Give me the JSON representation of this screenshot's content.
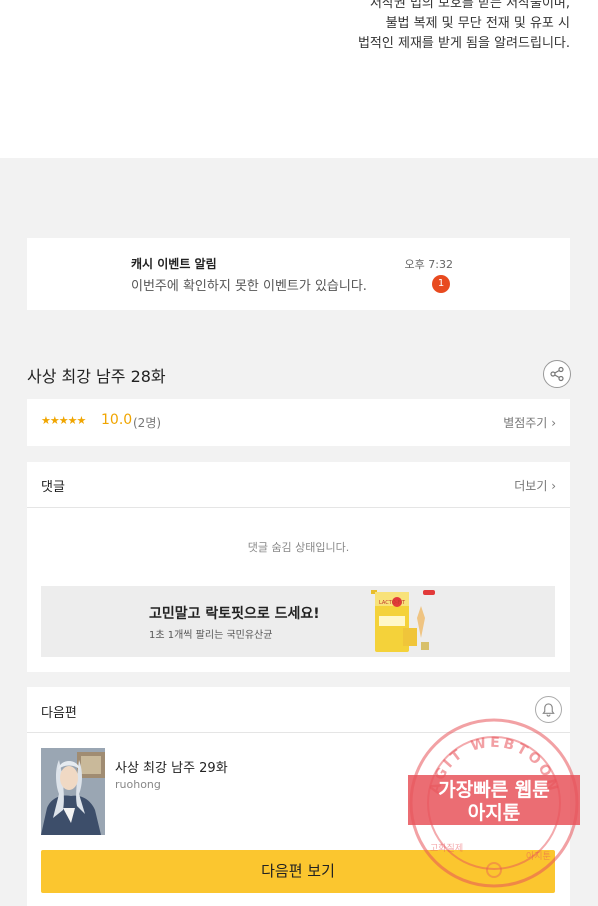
{
  "notice": {
    "lines": [
      "저작권 법의 보호를 받는 저작물이며,",
      "불법 복제 및 무단 전재 및 유포 시",
      "법적인 제재를 받게 됨을 알려드립니다."
    ]
  },
  "event": {
    "title": "캐시 이벤트 알림",
    "description": "이번주에 확인하지 못한 이벤트가 있습니다.",
    "time": "오후 7:32",
    "badge": "1"
  },
  "episode": {
    "title": "사상 최강 남주 28화",
    "share_icon": "share-icon"
  },
  "rating": {
    "stars": "★★★★★",
    "score": "10.0",
    "count": "(2명)",
    "rate_link": "별점주기",
    "star_color": "#f0a500"
  },
  "comments": {
    "label": "댓글",
    "more": "더보기",
    "hidden_message": "댓글 숨김 상태입니다."
  },
  "ad": {
    "title": "고민말고 락토핏으로 드세요!",
    "subtitle": "1초 1개씩 팔리는 국민유산균",
    "product_text": "LACTO-FIT"
  },
  "next_episode": {
    "label": "다음편",
    "title": "사상 최강 남주 29화",
    "author": "ruohong",
    "button": "다음편 보기",
    "button_color": "#fbc62f",
    "bell_icon": "bell-icon"
  },
  "watermark": {
    "arc_text": "AGIT WEBTOON",
    "line1": "가장빠른 웹툰",
    "line2": "아지툰",
    "bottom_left": "고화질제",
    "bottom_right": "아지툰",
    "color": "#e8535a"
  }
}
